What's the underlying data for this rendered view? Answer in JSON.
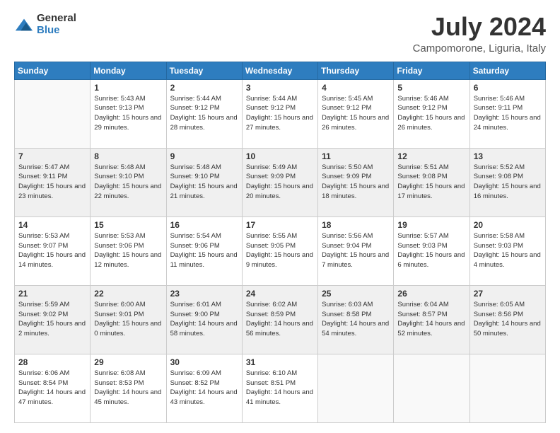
{
  "logo": {
    "general": "General",
    "blue": "Blue"
  },
  "title": "July 2024",
  "subtitle": "Campomorone, Liguria, Italy",
  "days": [
    "Sunday",
    "Monday",
    "Tuesday",
    "Wednesday",
    "Thursday",
    "Friday",
    "Saturday"
  ],
  "weeks": [
    [
      {
        "date": "",
        "sunrise": "",
        "sunset": "",
        "daylight": ""
      },
      {
        "date": "1",
        "sunrise": "Sunrise: 5:43 AM",
        "sunset": "Sunset: 9:13 PM",
        "daylight": "Daylight: 15 hours and 29 minutes."
      },
      {
        "date": "2",
        "sunrise": "Sunrise: 5:44 AM",
        "sunset": "Sunset: 9:12 PM",
        "daylight": "Daylight: 15 hours and 28 minutes."
      },
      {
        "date": "3",
        "sunrise": "Sunrise: 5:44 AM",
        "sunset": "Sunset: 9:12 PM",
        "daylight": "Daylight: 15 hours and 27 minutes."
      },
      {
        "date": "4",
        "sunrise": "Sunrise: 5:45 AM",
        "sunset": "Sunset: 9:12 PM",
        "daylight": "Daylight: 15 hours and 26 minutes."
      },
      {
        "date": "5",
        "sunrise": "Sunrise: 5:46 AM",
        "sunset": "Sunset: 9:12 PM",
        "daylight": "Daylight: 15 hours and 26 minutes."
      },
      {
        "date": "6",
        "sunrise": "Sunrise: 5:46 AM",
        "sunset": "Sunset: 9:11 PM",
        "daylight": "Daylight: 15 hours and 24 minutes."
      }
    ],
    [
      {
        "date": "7",
        "sunrise": "Sunrise: 5:47 AM",
        "sunset": "Sunset: 9:11 PM",
        "daylight": "Daylight: 15 hours and 23 minutes."
      },
      {
        "date": "8",
        "sunrise": "Sunrise: 5:48 AM",
        "sunset": "Sunset: 9:10 PM",
        "daylight": "Daylight: 15 hours and 22 minutes."
      },
      {
        "date": "9",
        "sunrise": "Sunrise: 5:48 AM",
        "sunset": "Sunset: 9:10 PM",
        "daylight": "Daylight: 15 hours and 21 minutes."
      },
      {
        "date": "10",
        "sunrise": "Sunrise: 5:49 AM",
        "sunset": "Sunset: 9:09 PM",
        "daylight": "Daylight: 15 hours and 20 minutes."
      },
      {
        "date": "11",
        "sunrise": "Sunrise: 5:50 AM",
        "sunset": "Sunset: 9:09 PM",
        "daylight": "Daylight: 15 hours and 18 minutes."
      },
      {
        "date": "12",
        "sunrise": "Sunrise: 5:51 AM",
        "sunset": "Sunset: 9:08 PM",
        "daylight": "Daylight: 15 hours and 17 minutes."
      },
      {
        "date": "13",
        "sunrise": "Sunrise: 5:52 AM",
        "sunset": "Sunset: 9:08 PM",
        "daylight": "Daylight: 15 hours and 16 minutes."
      }
    ],
    [
      {
        "date": "14",
        "sunrise": "Sunrise: 5:53 AM",
        "sunset": "Sunset: 9:07 PM",
        "daylight": "Daylight: 15 hours and 14 minutes."
      },
      {
        "date": "15",
        "sunrise": "Sunrise: 5:53 AM",
        "sunset": "Sunset: 9:06 PM",
        "daylight": "Daylight: 15 hours and 12 minutes."
      },
      {
        "date": "16",
        "sunrise": "Sunrise: 5:54 AM",
        "sunset": "Sunset: 9:06 PM",
        "daylight": "Daylight: 15 hours and 11 minutes."
      },
      {
        "date": "17",
        "sunrise": "Sunrise: 5:55 AM",
        "sunset": "Sunset: 9:05 PM",
        "daylight": "Daylight: 15 hours and 9 minutes."
      },
      {
        "date": "18",
        "sunrise": "Sunrise: 5:56 AM",
        "sunset": "Sunset: 9:04 PM",
        "daylight": "Daylight: 15 hours and 7 minutes."
      },
      {
        "date": "19",
        "sunrise": "Sunrise: 5:57 AM",
        "sunset": "Sunset: 9:03 PM",
        "daylight": "Daylight: 15 hours and 6 minutes."
      },
      {
        "date": "20",
        "sunrise": "Sunrise: 5:58 AM",
        "sunset": "Sunset: 9:03 PM",
        "daylight": "Daylight: 15 hours and 4 minutes."
      }
    ],
    [
      {
        "date": "21",
        "sunrise": "Sunrise: 5:59 AM",
        "sunset": "Sunset: 9:02 PM",
        "daylight": "Daylight: 15 hours and 2 minutes."
      },
      {
        "date": "22",
        "sunrise": "Sunrise: 6:00 AM",
        "sunset": "Sunset: 9:01 PM",
        "daylight": "Daylight: 15 hours and 0 minutes."
      },
      {
        "date": "23",
        "sunrise": "Sunrise: 6:01 AM",
        "sunset": "Sunset: 9:00 PM",
        "daylight": "Daylight: 14 hours and 58 minutes."
      },
      {
        "date": "24",
        "sunrise": "Sunrise: 6:02 AM",
        "sunset": "Sunset: 8:59 PM",
        "daylight": "Daylight: 14 hours and 56 minutes."
      },
      {
        "date": "25",
        "sunrise": "Sunrise: 6:03 AM",
        "sunset": "Sunset: 8:58 PM",
        "daylight": "Daylight: 14 hours and 54 minutes."
      },
      {
        "date": "26",
        "sunrise": "Sunrise: 6:04 AM",
        "sunset": "Sunset: 8:57 PM",
        "daylight": "Daylight: 14 hours and 52 minutes."
      },
      {
        "date": "27",
        "sunrise": "Sunrise: 6:05 AM",
        "sunset": "Sunset: 8:56 PM",
        "daylight": "Daylight: 14 hours and 50 minutes."
      }
    ],
    [
      {
        "date": "28",
        "sunrise": "Sunrise: 6:06 AM",
        "sunset": "Sunset: 8:54 PM",
        "daylight": "Daylight: 14 hours and 47 minutes."
      },
      {
        "date": "29",
        "sunrise": "Sunrise: 6:08 AM",
        "sunset": "Sunset: 8:53 PM",
        "daylight": "Daylight: 14 hours and 45 minutes."
      },
      {
        "date": "30",
        "sunrise": "Sunrise: 6:09 AM",
        "sunset": "Sunset: 8:52 PM",
        "daylight": "Daylight: 14 hours and 43 minutes."
      },
      {
        "date": "31",
        "sunrise": "Sunrise: 6:10 AM",
        "sunset": "Sunset: 8:51 PM",
        "daylight": "Daylight: 14 hours and 41 minutes."
      },
      {
        "date": "",
        "sunrise": "",
        "sunset": "",
        "daylight": ""
      },
      {
        "date": "",
        "sunrise": "",
        "sunset": "",
        "daylight": ""
      },
      {
        "date": "",
        "sunrise": "",
        "sunset": "",
        "daylight": ""
      }
    ]
  ]
}
